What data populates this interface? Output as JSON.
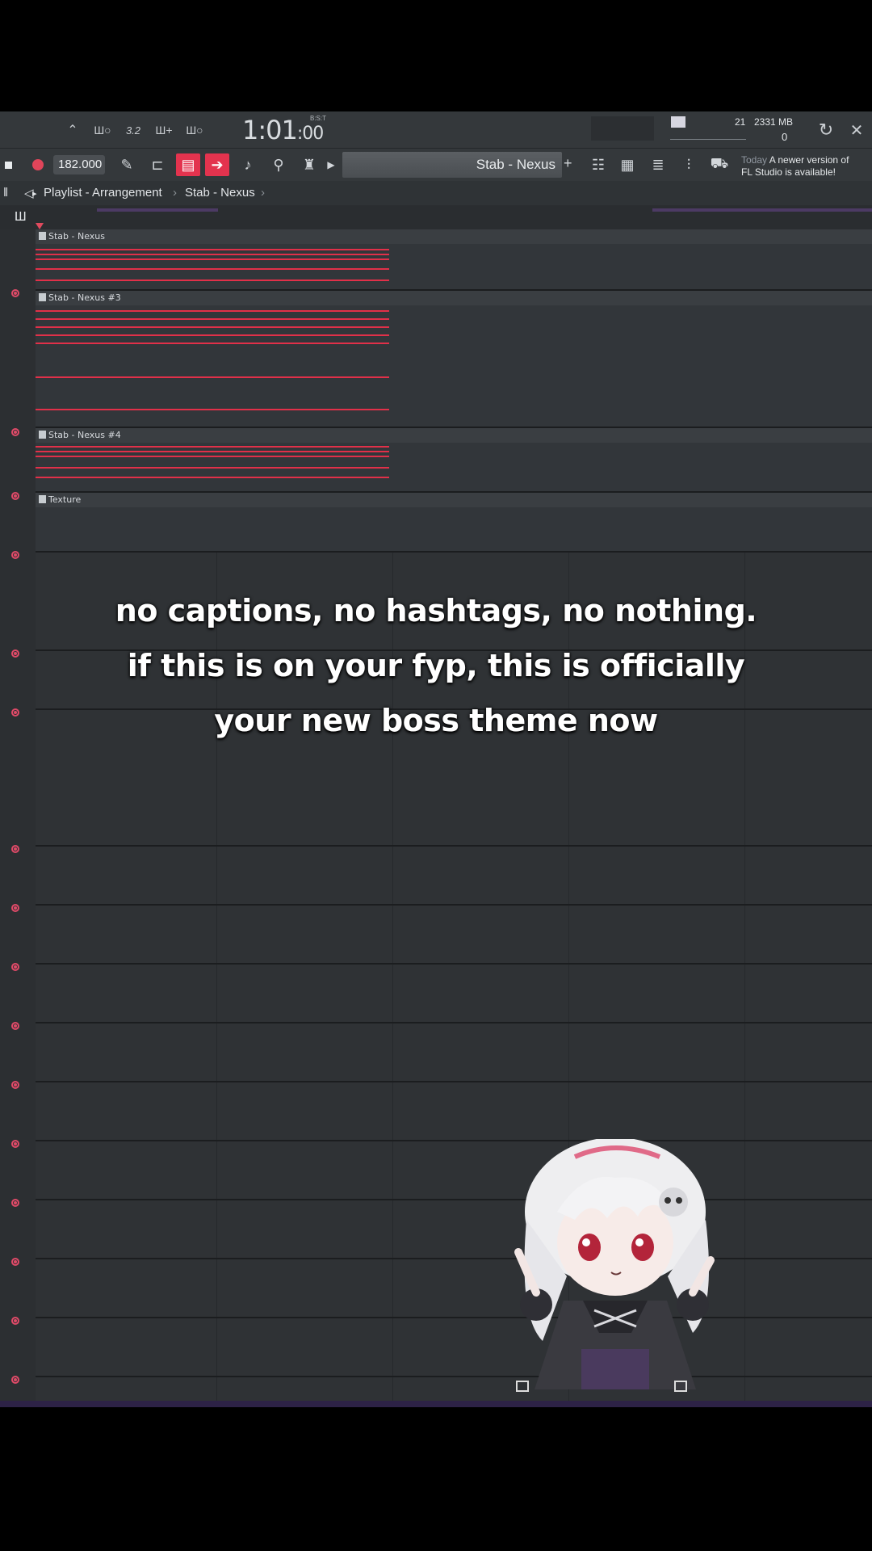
{
  "toolbar": {
    "time_main": "1:01",
    "time_sub": ":00",
    "time_mode": "B:S:T",
    "cpu_value": "21",
    "memory": "2331 MB",
    "polyphony": "0"
  },
  "toolbar2": {
    "tempo": "182.000",
    "pattern_name": "Stab - Nexus",
    "pattern_add": "+",
    "news_date": "Today",
    "news_text_1": "A newer version of",
    "news_text_2": "FL Studio is available!"
  },
  "playlist": {
    "title": "Playlist - Arrangement",
    "crumb_pattern": "Stab - Nexus",
    "sep": "›"
  },
  "tracks": [
    {
      "name": "Stab - Nexus"
    },
    {
      "name": "Stab - Nexus #3"
    },
    {
      "name": "Stab - Nexus #4"
    },
    {
      "name": "Texture"
    }
  ],
  "caption": {
    "line1": "no captions, no hashtags, no nothing.",
    "line2": "if this is on your fyp, this is officially",
    "line3": "your new boss theme now"
  },
  "colors": {
    "note_red": "#e13049",
    "accent_pink": "#e3334e",
    "bg_dark": "#2f3235"
  }
}
